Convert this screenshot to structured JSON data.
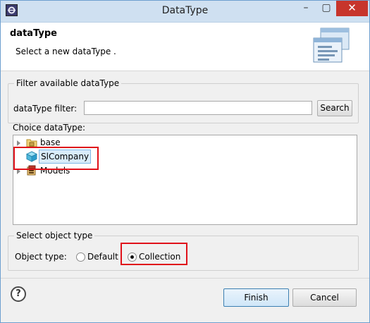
{
  "window": {
    "title": "DataType",
    "controls": {
      "minimize": "–",
      "maximize": "▢",
      "close": "✕"
    }
  },
  "header": {
    "title": "dataType",
    "description": "Select a new dataType ."
  },
  "filter": {
    "group_label": "Filter available dataType",
    "field_label": "dataType filter:",
    "value": "",
    "placeholder": "",
    "search_label": "Search"
  },
  "choice": {
    "label": "Choice dataType:",
    "tree": [
      {
        "label": "base",
        "icon": "package-folder-icon",
        "expandable": true,
        "selected": false
      },
      {
        "label": "SlCompany",
        "icon": "cube-icon",
        "expandable": false,
        "selected": true
      },
      {
        "label": "Models",
        "icon": "models-icon",
        "expandable": true,
        "selected": false
      }
    ]
  },
  "object_type": {
    "group_label": "Select object type",
    "field_label": "Object type:",
    "options": [
      {
        "label": "Default",
        "selected": false
      },
      {
        "label": "Collection",
        "selected": true
      }
    ]
  },
  "footer": {
    "help_symbol": "?",
    "finish_label": "Finish",
    "cancel_label": "Cancel"
  },
  "colors": {
    "highlight": "#e0111a",
    "title_bar": "#cfe0f1",
    "close_button": "#c7352c",
    "selection": "#d8ecfa"
  }
}
